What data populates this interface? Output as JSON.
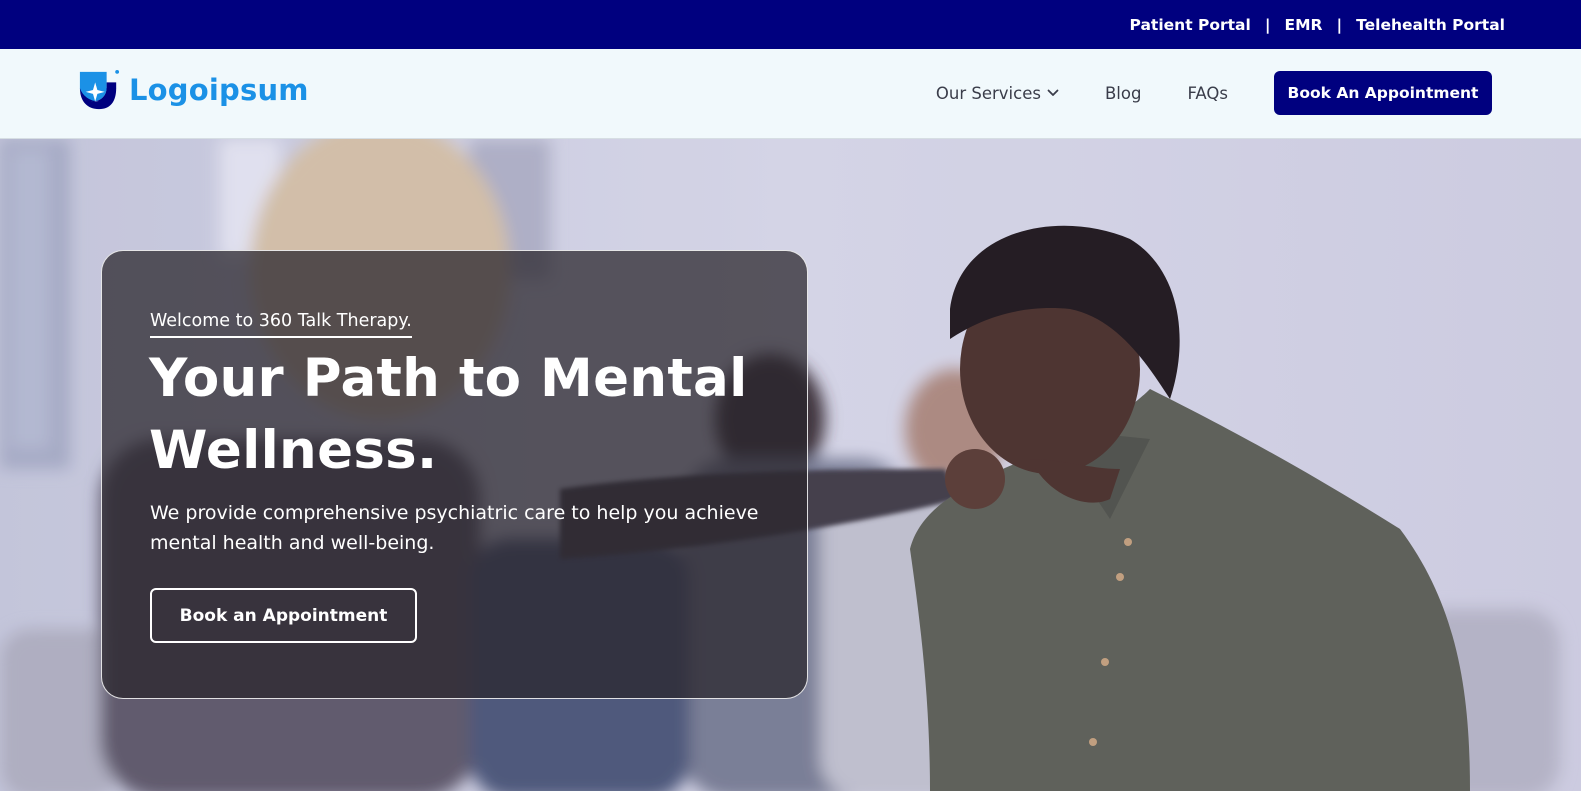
{
  "colors": {
    "topbar_bg": "#00007f",
    "header_bg": "#f1f9fc",
    "brand_blue": "#1b91e6",
    "cta_bg": "#00007f",
    "card_overlay": "#2a262c"
  },
  "topbar": {
    "links": [
      "Patient Portal",
      "EMR",
      "Telehealth Portal"
    ],
    "separator": "|"
  },
  "header": {
    "logo": {
      "icon": "shield-star-logo-icon",
      "text": "Logoipsum"
    },
    "nav": {
      "services": "Our Services",
      "services_icon": "chevron-down-icon",
      "blog": "Blog",
      "faqs": "FAQs"
    },
    "cta_label": "Book An Appointment"
  },
  "hero": {
    "eyebrow": "Welcome to 360 Talk Therapy.",
    "headline": "Your Path to Mental Wellness.",
    "subtext": "We provide comprehensive psychiatric care to help you achieve mental health and well-being.",
    "button_label": "Book an Appointment",
    "background": "group-therapy-session-photo"
  }
}
